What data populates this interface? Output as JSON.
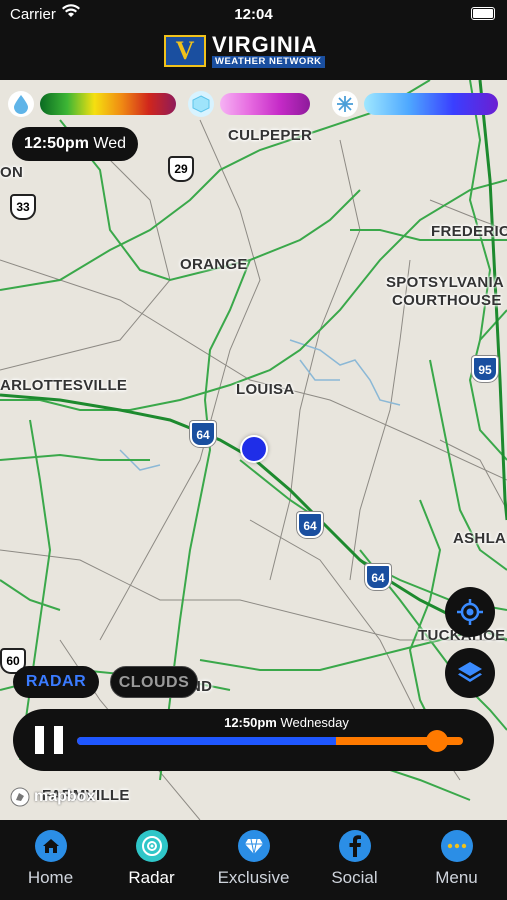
{
  "status_bar": {
    "carrier": "Carrier",
    "time": "12:04"
  },
  "app": {
    "logo_mark": "V",
    "logo_line1": "VIRGINIA",
    "logo_line2": "WEATHER NETWORK"
  },
  "legend": [
    {
      "icon": "rain-drop-icon",
      "glyph": "💧",
      "colors": [
        "#0a6b22",
        "#3db635",
        "#f5e010",
        "#f08a13",
        "#d0261c",
        "#8f1b5a"
      ]
    },
    {
      "icon": "ice-cube-icon",
      "glyph": "🧊",
      "colors": [
        "#f6b2f4",
        "#e66ae0",
        "#c52ac7",
        "#8e1b9b"
      ]
    },
    {
      "icon": "snowflake-icon",
      "glyph": "❄",
      "colors": [
        "#9fe7ff",
        "#4ea8ff",
        "#3a3fff",
        "#6b1fd2"
      ]
    }
  ],
  "map": {
    "timestamp_time": "12:50pm",
    "timestamp_day": "Wed",
    "labels": {
      "culpeper": "CULPEPER",
      "orange": "ORANGE",
      "fredericksburg": "FREDERIC",
      "spotsylvania_1": "SPOTSYLVANIA",
      "spotsylvania_2": "COURTHOUSE",
      "charlottesville": "ARLOTTESVILLE",
      "louisa": "LOUISA",
      "ashland": "ASHLA",
      "tuckahoe": "TUCKAHOE",
      "cumberland": "ND",
      "farmville": "FARMVILLE",
      "left_edge": "ON"
    },
    "shields": {
      "us29": "29",
      "us33": "33",
      "i64_a": "64",
      "i64_b": "64",
      "i64_c": "64",
      "i95": "95",
      "us60": "60"
    }
  },
  "toggles": {
    "radar": "RADAR",
    "clouds": "CLOUDS"
  },
  "player": {
    "time": "12:50pm",
    "day": "Wednesday",
    "progress": 0.67,
    "colors": {
      "past": "#1f57ff",
      "future": "#ff7a00"
    }
  },
  "attribution": "mapbox",
  "tabs": [
    {
      "label": "Home",
      "icon": "home-icon",
      "active": false
    },
    {
      "label": "Radar",
      "icon": "radar-icon",
      "active": true
    },
    {
      "label": "Exclusive",
      "icon": "diamond-icon",
      "active": false
    },
    {
      "label": "Social",
      "icon": "facebook-icon",
      "active": false
    },
    {
      "label": "Menu",
      "icon": "more-icon",
      "active": false
    }
  ]
}
